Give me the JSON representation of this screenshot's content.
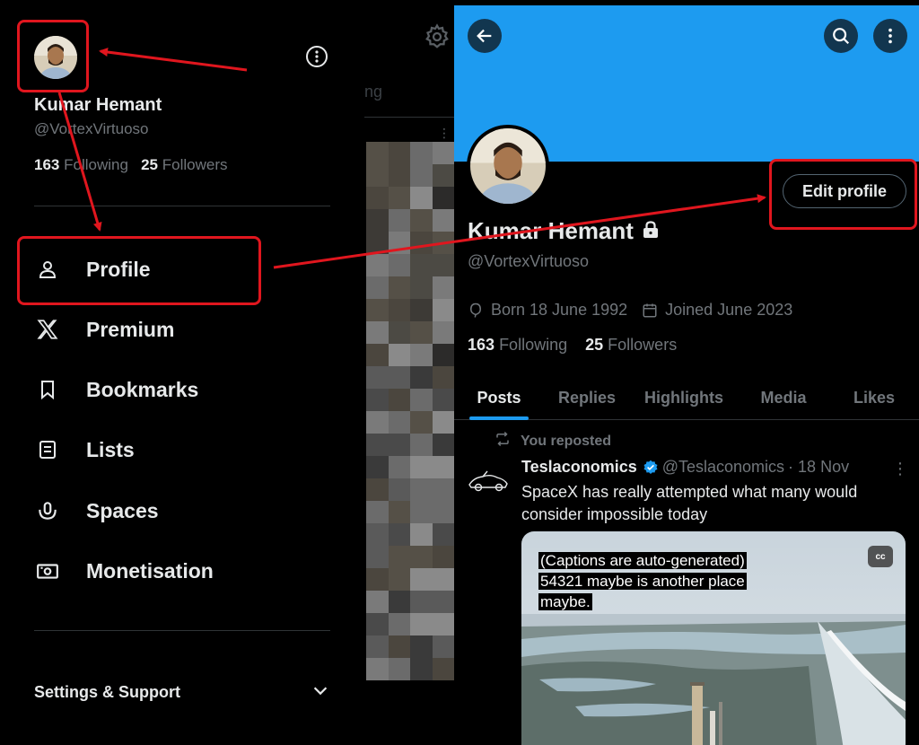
{
  "drawer": {
    "name": "Kumar Hemant",
    "handle": "@VortexVirtuoso",
    "following_count": "163",
    "following_label": "Following",
    "followers_count": "25",
    "followers_label": "Followers",
    "menu": [
      {
        "label": "Profile",
        "icon": "person-icon"
      },
      {
        "label": "Premium",
        "icon": "x-logo-icon"
      },
      {
        "label": "Bookmarks",
        "icon": "bookmark-icon"
      },
      {
        "label": "Lists",
        "icon": "list-icon"
      },
      {
        "label": "Spaces",
        "icon": "spaces-icon"
      },
      {
        "label": "Monetisation",
        "icon": "money-icon"
      }
    ],
    "settings_label": "Settings & Support"
  },
  "middle": {
    "tab_fragment": "ng"
  },
  "profile": {
    "name": "Kumar Hemant",
    "handle": "@VortexVirtuoso",
    "edit_button": "Edit profile",
    "born": "Born 18 June 1992",
    "joined": "Joined June 2023",
    "following_count": "163",
    "following_label": "Following",
    "followers_count": "25",
    "followers_label": "Followers",
    "tabs": [
      "Posts",
      "Replies",
      "Highlights",
      "Media",
      "Likes"
    ],
    "active_tab": "Posts"
  },
  "post": {
    "repost_label": "You reposted",
    "author": "Teslaconomics",
    "handle": "@Teslaconomics",
    "date": "· 18 Nov",
    "text": "SpaceX has really attempted what many would consider impossible today",
    "captions": [
      "(Captions are auto-generated)",
      "54321 maybe is another place",
      "maybe."
    ],
    "cc_label": "cc"
  },
  "colors": {
    "accent": "#1d9bf0",
    "highlight_red": "#e0161e",
    "background": "#000000"
  }
}
